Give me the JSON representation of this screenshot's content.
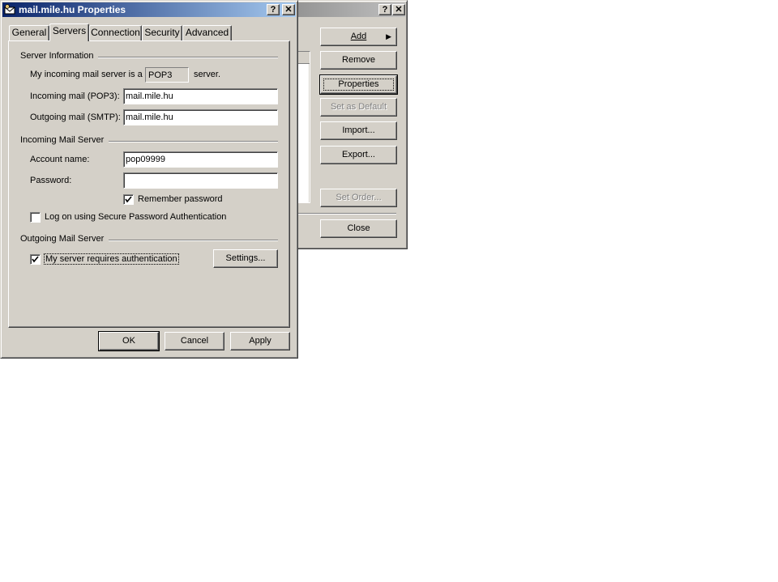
{
  "back_window": {
    "help_glyph": "?",
    "close_glyph": "✕",
    "buttons": {
      "add": "Add",
      "remove": "Remove",
      "properties": "Properties",
      "set_default": "Set as Default",
      "import": "Import...",
      "export": "Export...",
      "set_order": "Set Order...",
      "close": "Close"
    }
  },
  "dialog": {
    "title": "mail.mile.hu Properties",
    "help_glyph": "?",
    "close_glyph": "✕",
    "tabs": [
      "General",
      "Servers",
      "Connection",
      "Security",
      "Advanced"
    ],
    "selected_tab": "Servers",
    "server_info": {
      "header": "Server Information",
      "incoming_type_prefix": "My incoming mail server is a",
      "incoming_type_value": "POP3",
      "incoming_type_suffix": "server.",
      "incoming_label": "Incoming mail (POP3):",
      "incoming_value": "mail.mile.hu",
      "outgoing_label": "Outgoing mail (SMTP):",
      "outgoing_value": "mail.mile.hu"
    },
    "incoming_server": {
      "header": "Incoming Mail Server",
      "account_label": "Account name:",
      "account_value": "pop09999",
      "password_label": "Password:",
      "password_value": "",
      "remember_label": "Remember password",
      "remember_checked": true,
      "spa_label": "Log on using Secure Password Authentication",
      "spa_checked": false
    },
    "outgoing_server": {
      "header": "Outgoing Mail Server",
      "auth_label": "My server requires authentication",
      "auth_checked": true,
      "settings_button": "Settings..."
    },
    "footer": {
      "ok": "OK",
      "cancel": "Cancel",
      "apply": "Apply"
    }
  }
}
